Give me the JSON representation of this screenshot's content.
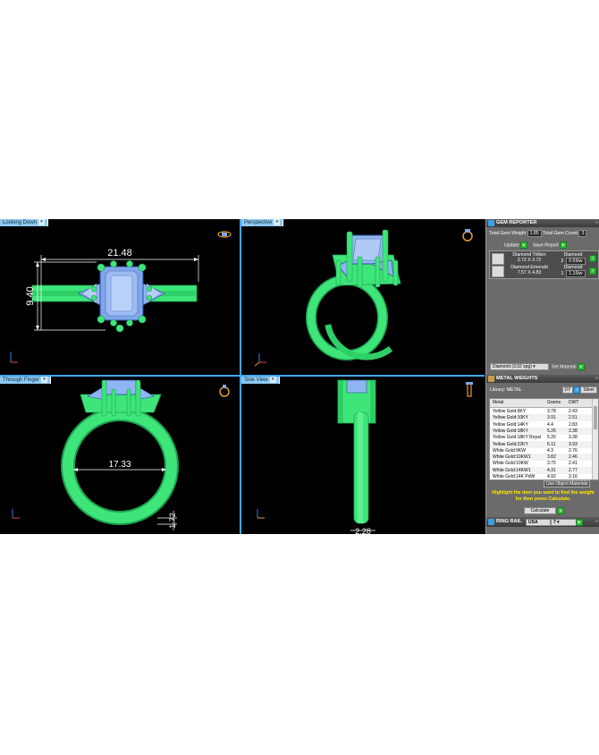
{
  "viewports": {
    "top_left": {
      "tab": "Looking Down",
      "dim_width": "21.48",
      "dim_height": "9.40"
    },
    "top_right": {
      "tab": "Perspective"
    },
    "bottom_left": {
      "tab": "Through Finger",
      "dim_inner": "17.33",
      "dim_band": "1.72"
    },
    "bottom_right": {
      "tab": "Side View",
      "dim_width": "2.28"
    }
  },
  "gem_reporter": {
    "title": "GEM REPORTER",
    "total_weight_label": "Total Gem Weight",
    "total_weight_value": "1.85",
    "total_count_label": "Total Gem Count",
    "total_count_value": "3",
    "update_label": "Update",
    "save_label": "Save Report",
    "gems": [
      {
        "name": "Diamond Trillion",
        "size": "3.72 X 3.72",
        "material": "Diamond",
        "count": "2",
        "weight": "0.69tw"
      },
      {
        "name": "Diamond Emerald",
        "size": "7.57 X 4.83",
        "material": "Diamond",
        "count": "1",
        "weight": "1.16tw"
      }
    ],
    "material_select": "Diamond  (3.52 spg)",
    "set_material_label": "Set Material"
  },
  "metal_weights": {
    "title": "METAL WEIGHTS",
    "library_label": "Library: METAL",
    "unit_a": "DY",
    "unit_b": "Silver",
    "columns": [
      "Metal",
      "Grams",
      "DWT"
    ],
    "rows": [
      [
        "Yellow Gold:9KY",
        "3.78",
        "2.43"
      ],
      [
        "Yellow Gold:10KY",
        "3.91",
        "2.51"
      ],
      [
        "Yellow Gold:14KY",
        "4.4",
        "2.83"
      ],
      [
        "Yellow Gold:18KY",
        "5.26",
        "3.38"
      ],
      [
        "Yellow Gold:18KY Royal",
        "5.26",
        "3.38"
      ],
      [
        "Yellow Gold:22KY",
        "6.11",
        "3.93"
      ],
      [
        "White Gold:9KW",
        "4.3",
        "2.76"
      ],
      [
        "White Gold:10KW1",
        "3.82",
        "2.46"
      ],
      [
        "White Gold:10KW",
        "3.75",
        "2.41"
      ],
      [
        "White Gold:14KW1",
        "4.31",
        "2.77"
      ],
      [
        "White Gold:14K PdW",
        "4.92",
        "3.16"
      ]
    ],
    "use_object_materials": "Use Object Materials",
    "hint": "Highlight the item you want to find the weight for then press Calculate.",
    "calculate_label": "Calculate"
  },
  "ring_rail": {
    "title": "RING RAIL",
    "region": "USA",
    "size": "7"
  },
  "colors": {
    "metal_green": "#3ee67a",
    "gem_blue": "#8fb6f2",
    "viewport_border": "#3fa7f5",
    "panel_bg": "#6b6b6b"
  }
}
